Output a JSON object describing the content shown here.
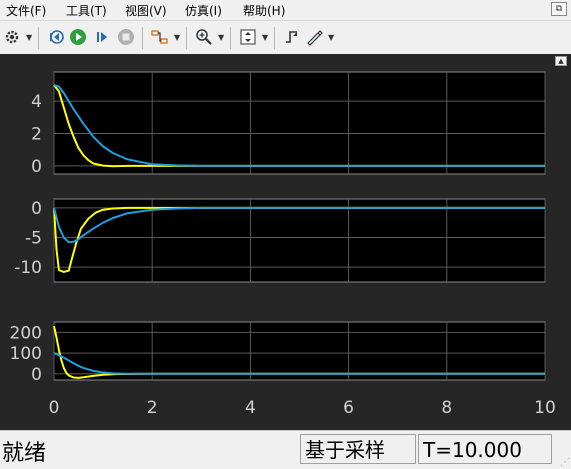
{
  "menu": {
    "items": [
      {
        "label": "文件(F)",
        "mnemonic": "F"
      },
      {
        "label": "工具(T)",
        "mnemonic": "T"
      },
      {
        "label": "视图(V)",
        "mnemonic": "V"
      },
      {
        "label": "仿真(I)",
        "mnemonic": "I"
      },
      {
        "label": "帮助(H)",
        "mnemonic": "H"
      }
    ]
  },
  "toolbar": {
    "icons": [
      "gear-icon",
      "step-back-icon",
      "run-icon",
      "step-forward-icon",
      "stop-icon",
      "signal-highlight-icon",
      "zoom-icon",
      "autoscale-icon",
      "cursor-measure-icon",
      "triggers-icon"
    ]
  },
  "colors": {
    "scope_bg": "#000000",
    "frame_bg": "#262626",
    "grid": "#5a5a5a",
    "axis_text": "#d0d0d0",
    "series_yellow": "#ffff00",
    "series_blue": "#1f9de0"
  },
  "chart_data": [
    {
      "type": "line",
      "x_tick_labels": [],
      "y_tick_labels": [
        "4",
        "2",
        "0"
      ],
      "xlim": [
        0,
        10
      ],
      "ylim": [
        -0.5,
        5.8
      ],
      "yticks": [
        4,
        2,
        0
      ],
      "grid": true,
      "series": [
        {
          "color": "#ffff00",
          "x": [
            0,
            0.1,
            0.2,
            0.3,
            0.4,
            0.5,
            0.6,
            0.7,
            0.8,
            1.0,
            1.2,
            1.5,
            2.0,
            3.0,
            10
          ],
          "y": [
            5.0,
            4.6,
            3.6,
            2.6,
            1.8,
            1.1,
            0.65,
            0.35,
            0.15,
            0.02,
            -0.02,
            0,
            0,
            0,
            0
          ]
        },
        {
          "color": "#1f9de0",
          "x": [
            0,
            0.1,
            0.2,
            0.3,
            0.4,
            0.6,
            0.8,
            1.0,
            1.2,
            1.5,
            2.0,
            2.5,
            3.0,
            10
          ],
          "y": [
            5.0,
            4.9,
            4.5,
            4.0,
            3.5,
            2.6,
            1.8,
            1.2,
            0.8,
            0.4,
            0.1,
            0.03,
            0,
            0
          ]
        }
      ]
    },
    {
      "type": "line",
      "x_tick_labels": [],
      "y_tick_labels": [
        "0",
        "-5",
        "-10"
      ],
      "xlim": [
        0,
        10
      ],
      "ylim": [
        -12.5,
        1.5
      ],
      "yticks": [
        0,
        -5,
        -10
      ],
      "grid": true,
      "series": [
        {
          "color": "#ffff00",
          "x": [
            0,
            0.05,
            0.1,
            0.2,
            0.3,
            0.35,
            0.45,
            0.55,
            0.7,
            0.85,
            1.0,
            1.2,
            1.5,
            2.0,
            10
          ],
          "y": [
            0,
            -7,
            -10.5,
            -10.8,
            -10.6,
            -9.0,
            -6.0,
            -3.5,
            -1.8,
            -0.8,
            -0.3,
            -0.1,
            0,
            0,
            0
          ]
        },
        {
          "color": "#1f9de0",
          "x": [
            0,
            0.1,
            0.2,
            0.3,
            0.4,
            0.5,
            0.6,
            0.8,
            1.0,
            1.2,
            1.5,
            2.0,
            2.5,
            3.0,
            10
          ],
          "y": [
            0,
            -3.2,
            -5.0,
            -5.8,
            -5.7,
            -5.3,
            -4.6,
            -3.5,
            -2.5,
            -1.7,
            -0.9,
            -0.3,
            -0.1,
            0,
            0
          ]
        }
      ]
    },
    {
      "type": "line",
      "x_tick_labels": [
        "0",
        "2",
        "4",
        "6",
        "8",
        "10"
      ],
      "y_tick_labels": [
        "200",
        "100",
        "0"
      ],
      "xlim": [
        0,
        10
      ],
      "ylim": [
        -30,
        250
      ],
      "yticks": [
        200,
        100,
        0
      ],
      "grid": true,
      "series": [
        {
          "color": "#ffff00",
          "x": [
            0,
            0.05,
            0.1,
            0.15,
            0.2,
            0.25,
            0.3,
            0.4,
            0.5,
            0.6,
            0.8,
            1.0,
            1.3,
            2.0,
            10
          ],
          "y": [
            230,
            175,
            115,
            65,
            28,
            5,
            -8,
            -18,
            -20,
            -17,
            -10,
            -5,
            -1,
            0,
            0
          ]
        },
        {
          "color": "#1f9de0",
          "x": [
            0,
            0.1,
            0.2,
            0.3,
            0.4,
            0.5,
            0.6,
            0.8,
            1.0,
            1.2,
            1.5,
            2.0,
            3.0,
            10
          ],
          "y": [
            100,
            90,
            78,
            64,
            50,
            38,
            28,
            14,
            6,
            2,
            0,
            0,
            0,
            0
          ]
        }
      ]
    }
  ],
  "status": {
    "state": "就绪",
    "mode": "基于采样",
    "time": "T=10.000"
  }
}
